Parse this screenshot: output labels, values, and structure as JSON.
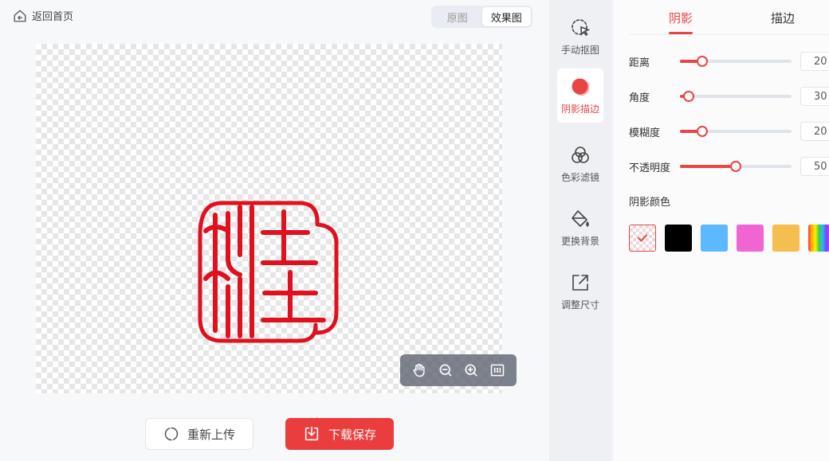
{
  "header": {
    "back_label": "返回首页",
    "view_original": "原图",
    "view_result": "效果图"
  },
  "toolbar": {
    "reupload_label": "重新上传",
    "download_label": "下载保存"
  },
  "tools": [
    {
      "label": "手动抠图",
      "icon": "cursor-select-icon"
    },
    {
      "label": "阴影描边",
      "icon": "shadow-circle-icon"
    },
    {
      "label": "色彩滤镜",
      "icon": "color-filter-icon"
    },
    {
      "label": "更换背景",
      "icon": "paint-bucket-icon"
    },
    {
      "label": "调整尺寸",
      "icon": "resize-icon"
    }
  ],
  "panel": {
    "tab_shadow": "阴影",
    "tab_stroke": "描边",
    "sliders": [
      {
        "label": "距离",
        "value": "20",
        "unit": "",
        "fraction": 0.2
      },
      {
        "label": "角度",
        "value": "30",
        "unit": "",
        "fraction": 0.08
      },
      {
        "label": "模糊度",
        "value": "20",
        "unit": "%",
        "fraction": 0.2
      },
      {
        "label": "不透明度",
        "value": "50",
        "unit": "%",
        "fraction": 0.5
      }
    ],
    "color_label": "阴影颜色",
    "swatches": [
      "none",
      "#000000",
      "#5cb8ff",
      "#f065d1",
      "#f6bd4f",
      "rainbow"
    ]
  },
  "colors": {
    "accent": "#e84545",
    "seal": "#e0101e"
  }
}
